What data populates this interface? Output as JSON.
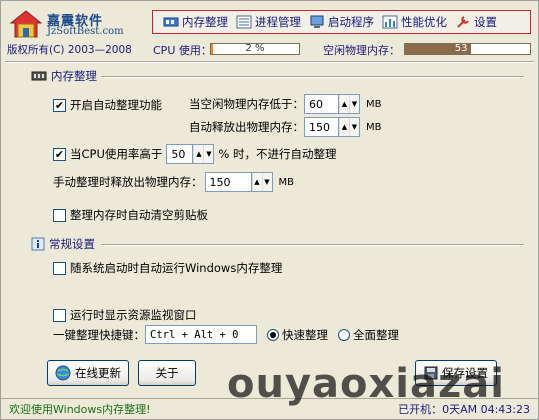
{
  "header": {
    "app_name": "嘉震软件",
    "url_text": "JzSoftBest.com",
    "copyright": "版权所有(C) 2003—2008"
  },
  "nav": [
    {
      "label": "内存整理",
      "icon": "memory-chip-icon"
    },
    {
      "label": "进程管理",
      "icon": "list-icon"
    },
    {
      "label": "启动程序",
      "icon": "computer-icon"
    },
    {
      "label": "性能优化",
      "icon": "bar-chart-icon"
    },
    {
      "label": "设置",
      "icon": "wrench-icon"
    }
  ],
  "cpu": {
    "label": "CPU 使用：",
    "percent": 2,
    "text": "2 %",
    "color": "#f28c1c"
  },
  "memory": {
    "label": "空闲物理内存：",
    "percent": 53,
    "text": "53 %",
    "color": "#8b6b4a"
  },
  "memory_section": {
    "title": "内存整理",
    "auto_enable": {
      "label": "开启自动整理功能",
      "checked": true
    },
    "threshold_label": "当空闲物理内存低于：",
    "threshold_value": "60",
    "auto_release_label": "自动释放出物理内存：",
    "auto_release_value": "150",
    "unit": "MB",
    "cpu_limit": {
      "prefix": "当CPU使用率高于",
      "value": "50",
      "suffix": "% 时，不进行自动整理",
      "checked": true
    },
    "manual_label": "手动整理时释放出物理内存：",
    "manual_value": "150",
    "clear_clipboard": {
      "label": "整理内存时自动清空剪贴板",
      "checked": false
    }
  },
  "general_section": {
    "title": "常规设置",
    "autostart": {
      "label": "随系统启动时自动运行Windows内存整理",
      "checked": false
    },
    "show_monitor": {
      "label": "运行时显示资源监视窗口",
      "checked": false
    },
    "hotkey_label": "一键整理快捷键：",
    "hotkey_value": "Ctrl + Alt + 0",
    "mode_quick": "快速整理",
    "mode_full": "全面整理",
    "selected_mode": "快速整理"
  },
  "buttons": {
    "update": "在线更新",
    "about": "关于",
    "save": "保存设置"
  },
  "status": {
    "welcome": "欢迎使用Windows内存整理!",
    "uptime": "已开机：0天AM 04:43:23"
  },
  "watermark": "ouyaoxiazai"
}
